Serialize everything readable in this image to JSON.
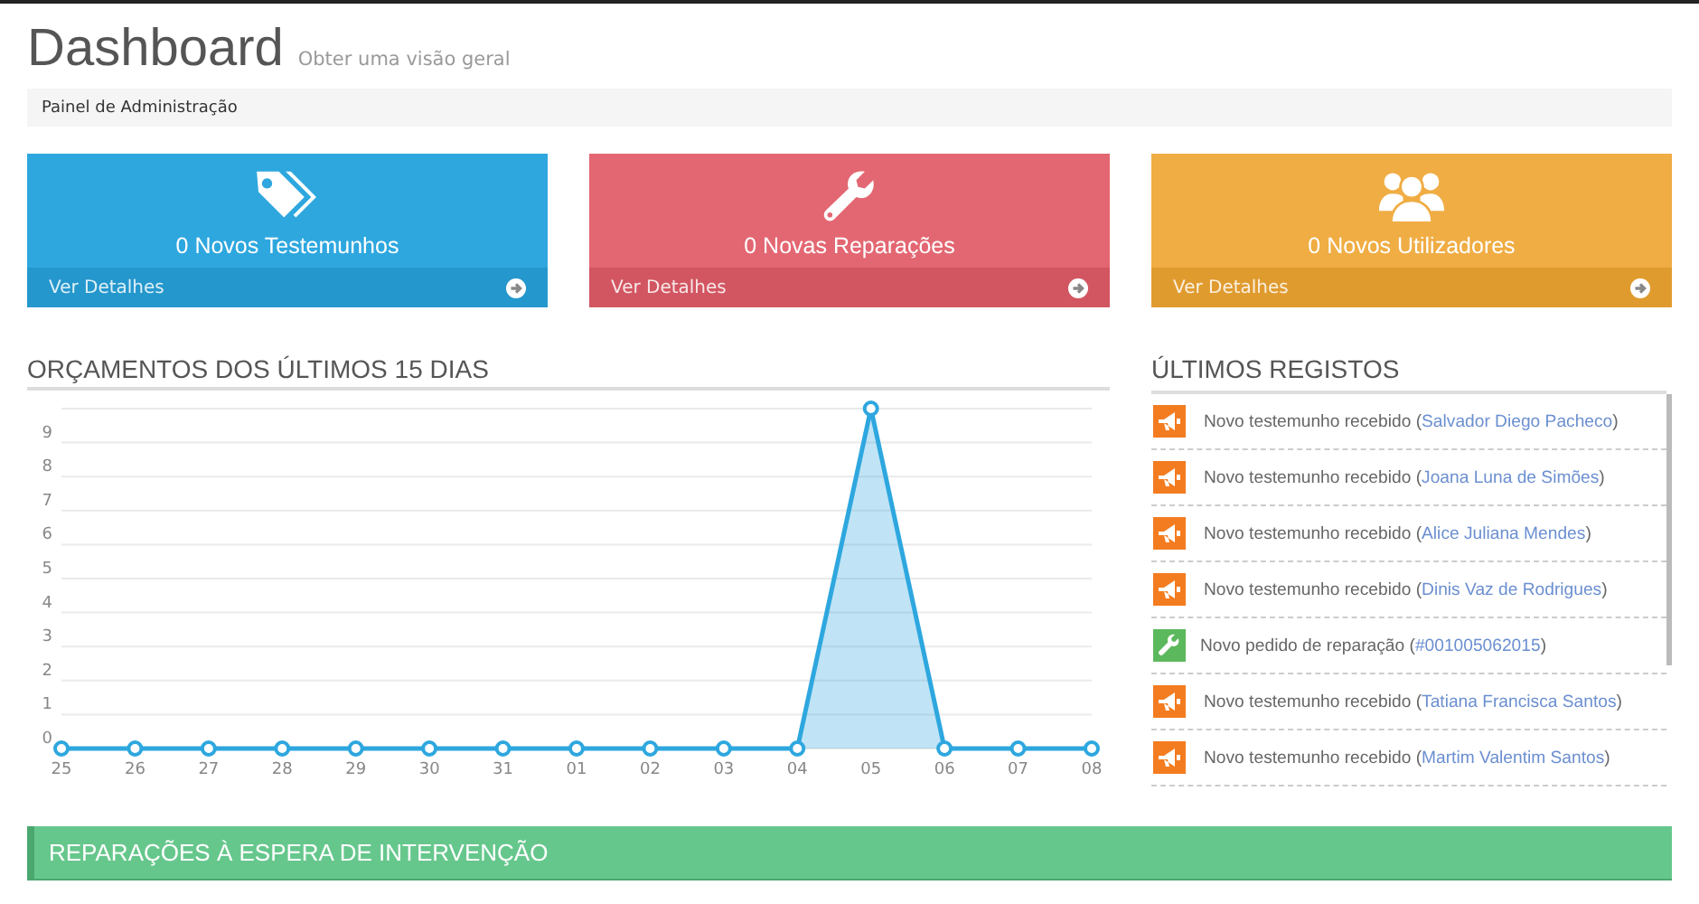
{
  "header": {
    "title": "Dashboard",
    "subtitle": "Obter uma visão geral"
  },
  "breadcrumb": "Painel de Administração",
  "cards": [
    {
      "kind": "testimonials",
      "label": "0 Novos Testemunhos",
      "link": "Ver Detalhes"
    },
    {
      "kind": "repairs",
      "label": "0 Novas Reparações",
      "link": "Ver Detalhes"
    },
    {
      "kind": "users",
      "label": "0 Novos Utilizadores",
      "link": "Ver Detalhes"
    }
  ],
  "budgets": {
    "title": "ORÇAMENTOS DOS ÚLTIMOS 15 DIAS",
    "chart_data": {
      "type": "area",
      "categories": [
        "25",
        "26",
        "27",
        "28",
        "29",
        "30",
        "31",
        "01",
        "02",
        "03",
        "04",
        "05",
        "06",
        "07",
        "08"
      ],
      "series": [
        {
          "color": "#2ea7df",
          "values": [
            0,
            0,
            0,
            0,
            0,
            0,
            0,
            0,
            0,
            0,
            0,
            10,
            0,
            0,
            0
          ]
        }
      ],
      "ylim": [
        0,
        10
      ],
      "grid": true,
      "yticks": [
        0,
        1,
        2,
        3,
        4,
        5,
        6,
        7,
        8,
        9
      ]
    }
  },
  "log": {
    "title": "ÚLTIMOS REGISTOS",
    "items": [
      {
        "kind": "testimonial",
        "text": "Novo testemunho recebido (",
        "link": "Salvador Diego Pacheco",
        "end": ")"
      },
      {
        "kind": "testimonial",
        "text": "Novo testemunho recebido (",
        "link": "Joana Luna de Simões",
        "end": ")"
      },
      {
        "kind": "testimonial",
        "text": "Novo testemunho recebido (",
        "link": "Alice Juliana Mendes",
        "end": ")"
      },
      {
        "kind": "testimonial",
        "text": "Novo testemunho recebido (",
        "link": "Dinis Vaz de Rodrigues",
        "end": ")"
      },
      {
        "kind": "repair",
        "text": "Novo pedido de reparação (",
        "link": "#001005062015",
        "end": ")"
      },
      {
        "kind": "testimonial",
        "text": "Novo testemunho recebido (",
        "link": "Tatiana Francisca Santos",
        "end": ")"
      },
      {
        "kind": "testimonial",
        "text": "Novo testemunho recebido (",
        "link": "Martim Valentim Santos",
        "end": ")"
      }
    ]
  },
  "pending": {
    "title": "REPARAÇÕES À ESPERA DE INTERVENÇÃO"
  }
}
